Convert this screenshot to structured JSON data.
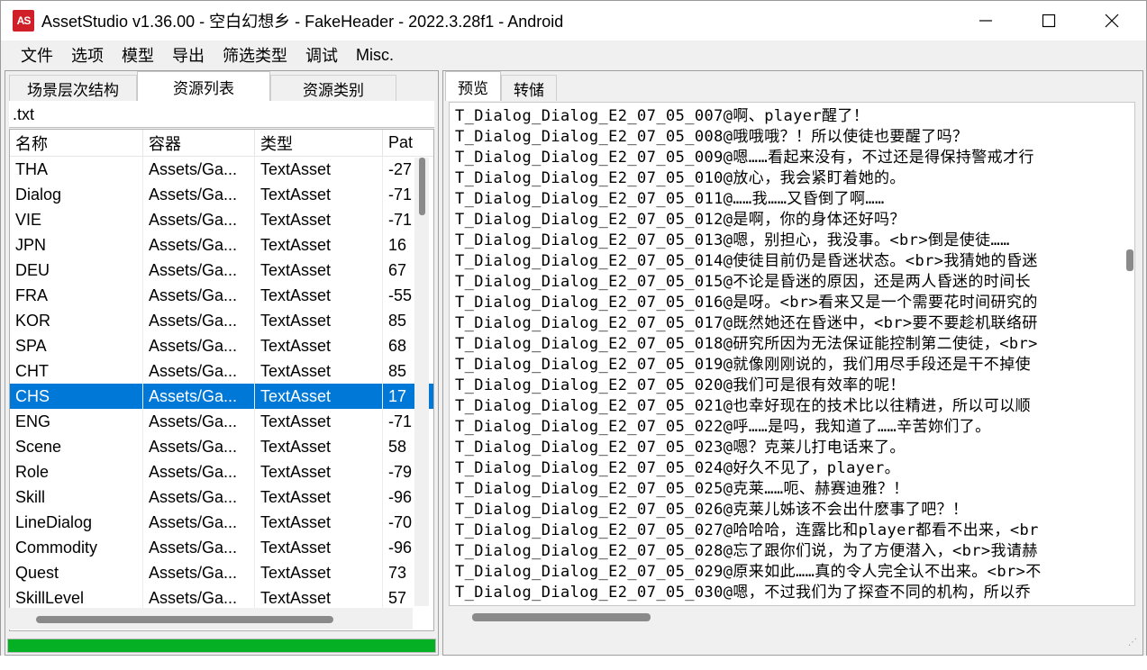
{
  "window": {
    "app_icon_text": "AS",
    "title": "AssetStudio v1.36.00 - 空白幻想乡 - FakeHeader - 2022.3.28f1 - Android",
    "controls": {
      "minimize": "minimize-icon",
      "maximize": "maximize-icon",
      "close": "close-icon"
    }
  },
  "menu": [
    "文件",
    "选项",
    "模型",
    "导出",
    "筛选类型",
    "调试",
    "Misc."
  ],
  "left_panel": {
    "tabs": [
      "场景层次结构",
      "资源列表",
      "资源类别"
    ],
    "active_tab": 1,
    "filter_value": ".txt",
    "columns": [
      "名称",
      "容器",
      "类型",
      "Pat"
    ],
    "rows": [
      {
        "name": "THA",
        "container": "Assets/Ga...",
        "type": "TextAsset",
        "path": "-27"
      },
      {
        "name": "Dialog",
        "container": "Assets/Ga...",
        "type": "TextAsset",
        "path": "-71"
      },
      {
        "name": "VIE",
        "container": "Assets/Ga...",
        "type": "TextAsset",
        "path": "-71"
      },
      {
        "name": "JPN",
        "container": "Assets/Ga...",
        "type": "TextAsset",
        "path": "16"
      },
      {
        "name": "DEU",
        "container": "Assets/Ga...",
        "type": "TextAsset",
        "path": "67"
      },
      {
        "name": "FRA",
        "container": "Assets/Ga...",
        "type": "TextAsset",
        "path": "-55"
      },
      {
        "name": "KOR",
        "container": "Assets/Ga...",
        "type": "TextAsset",
        "path": "85"
      },
      {
        "name": "SPA",
        "container": "Assets/Ga...",
        "type": "TextAsset",
        "path": "68"
      },
      {
        "name": "CHT",
        "container": "Assets/Ga...",
        "type": "TextAsset",
        "path": "85"
      },
      {
        "name": "CHS",
        "container": "Assets/Ga...",
        "type": "TextAsset",
        "path": "17"
      },
      {
        "name": "ENG",
        "container": "Assets/Ga...",
        "type": "TextAsset",
        "path": "-71"
      },
      {
        "name": "Scene",
        "container": "Assets/Ga...",
        "type": "TextAsset",
        "path": "58"
      },
      {
        "name": "Role",
        "container": "Assets/Ga...",
        "type": "TextAsset",
        "path": "-79"
      },
      {
        "name": "Skill",
        "container": "Assets/Ga...",
        "type": "TextAsset",
        "path": "-96"
      },
      {
        "name": "LineDialog",
        "container": "Assets/Ga...",
        "type": "TextAsset",
        "path": "-70"
      },
      {
        "name": "Commodity",
        "container": "Assets/Ga...",
        "type": "TextAsset",
        "path": "-96"
      },
      {
        "name": "Quest",
        "container": "Assets/Ga...",
        "type": "TextAsset",
        "path": "73"
      },
      {
        "name": "SkillLevel",
        "container": "Assets/Ga...",
        "type": "TextAsset",
        "path": "57"
      }
    ],
    "selected_row": 9,
    "progress_fraction": 1.0,
    "progress_color": "#06b025"
  },
  "right_panel": {
    "tabs": [
      "预览",
      "转储"
    ],
    "active_tab": 0,
    "preview_lines": [
      "T_Dialog_Dialog_E2_07_05_007@啊、player醒了！",
      "T_Dialog_Dialog_E2_07_05_008@哦哦哦？！所以使徒也要醒了吗？",
      "T_Dialog_Dialog_E2_07_05_009@嗯……看起来没有，不过还是得保持警戒才行",
      "T_Dialog_Dialog_E2_07_05_010@放心，我会紧盯着她的。",
      "T_Dialog_Dialog_E2_07_05_011@……我……又昏倒了啊……",
      "T_Dialog_Dialog_E2_07_05_012@是啊，你的身体还好吗？",
      "T_Dialog_Dialog_E2_07_05_013@嗯，别担心，我没事。<br>倒是使徒……",
      "T_Dialog_Dialog_E2_07_05_014@使徒目前仍是昏迷状态。<br>我猜她的昏迷",
      "T_Dialog_Dialog_E2_07_05_015@不论是昏迷的原因，还是两人昏迷的时间长",
      "T_Dialog_Dialog_E2_07_05_016@是呀。<br>看来又是一个需要花时间研究的",
      "T_Dialog_Dialog_E2_07_05_017@既然她还在昏迷中，<br>要不要趁机联络研",
      "T_Dialog_Dialog_E2_07_05_018@研究所因为无法保证能控制第二使徒，<br>",
      "T_Dialog_Dialog_E2_07_05_019@就像刚刚说的，我们用尽手段还是干不掉使",
      "T_Dialog_Dialog_E2_07_05_020@我们可是很有效率的呢！",
      "T_Dialog_Dialog_E2_07_05_021@也幸好现在的技术比以往精进，所以可以顺",
      "T_Dialog_Dialog_E2_07_05_022@呼……是吗，我知道了……辛苦妳们了。",
      "T_Dialog_Dialog_E2_07_05_023@嗯？克莱儿打电话来了。",
      "T_Dialog_Dialog_E2_07_05_024@好久不见了，player。",
      "T_Dialog_Dialog_E2_07_05_025@克莱……呃、赫赛迪雅？！",
      "T_Dialog_Dialog_E2_07_05_026@克莱儿姊该不会出什麽事了吧？！",
      "T_Dialog_Dialog_E2_07_05_027@哈哈哈，连露比和player都看不出来，<br",
      "T_Dialog_Dialog_E2_07_05_028@忘了跟你们说，为了方便潜入，<br>我请赫",
      "T_Dialog_Dialog_E2_07_05_029@原来如此……真的令人完全认不出来。<br>不",
      "T_Dialog_Dialog_E2_07_05_030@嗯，不过我们为了探查不同的机构，所以乔"
    ]
  }
}
